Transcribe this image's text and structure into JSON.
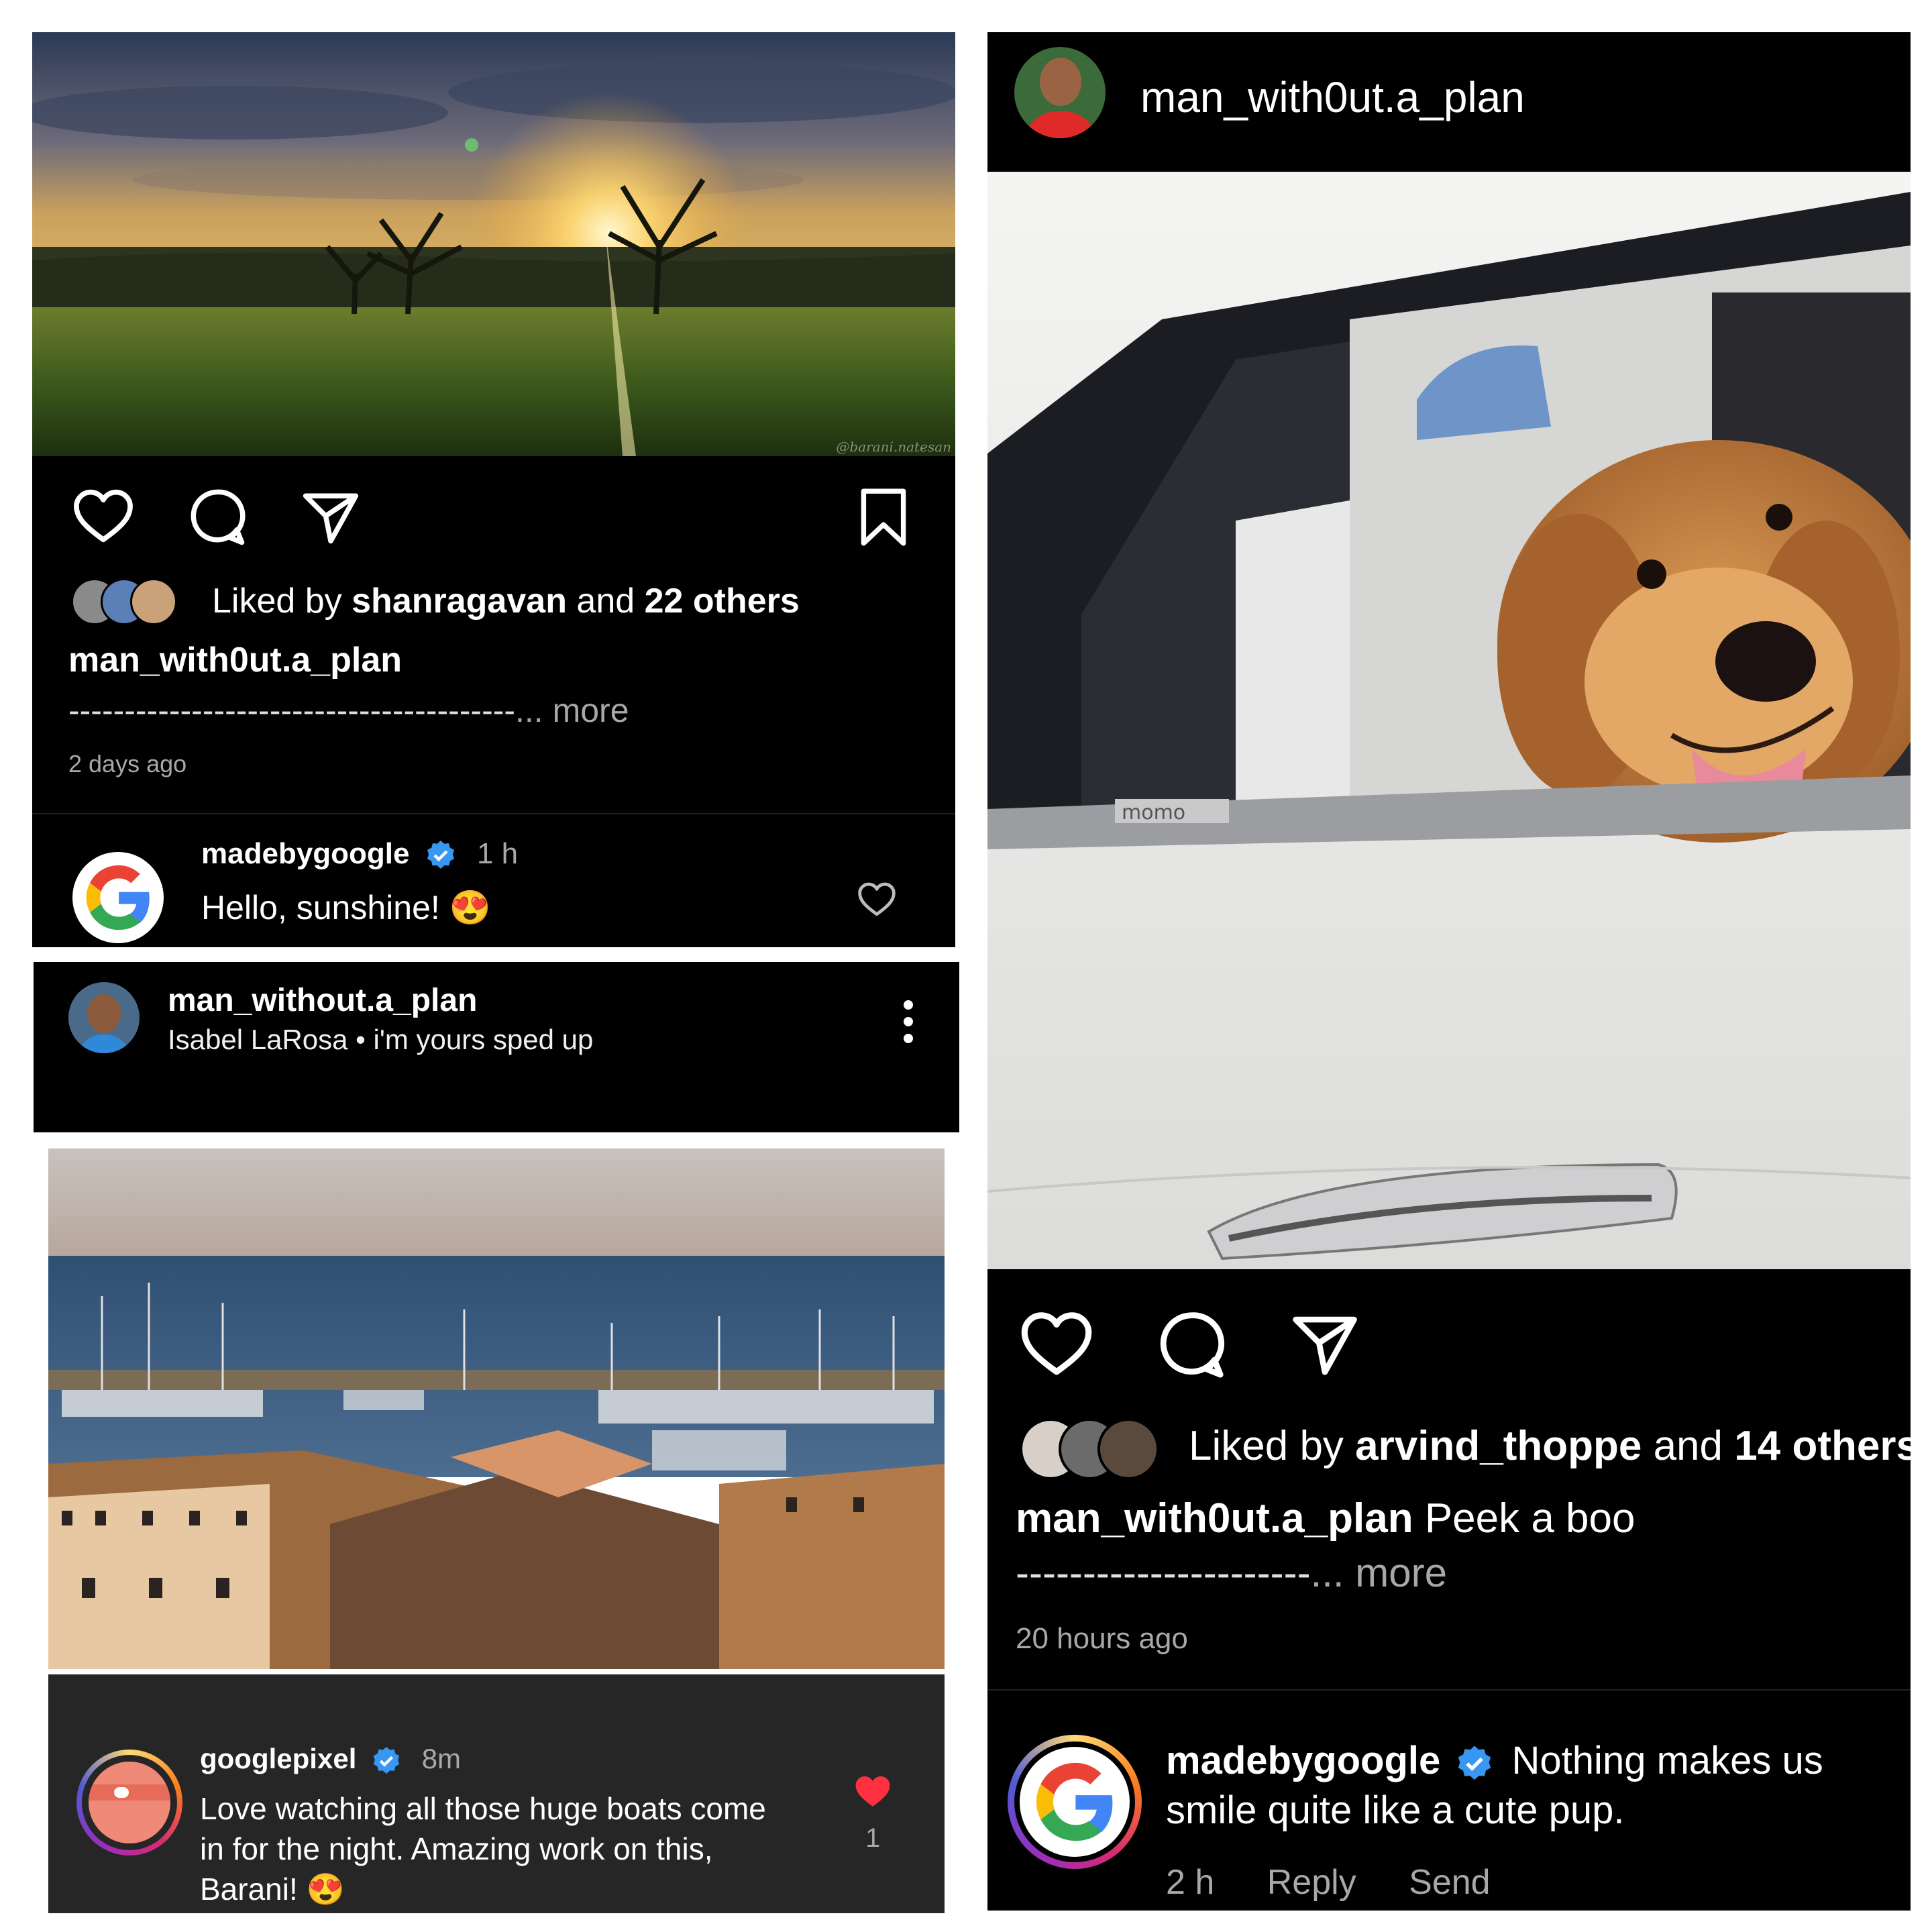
{
  "post1": {
    "photo_watermark": "@barani.natesan",
    "liked_prefix": "Liked by",
    "liked_user": "shanragavan",
    "liked_and": "and",
    "liked_others": "22 others",
    "author": "man_with0ut.a_plan",
    "caption_dashes": "----------------------------------------",
    "caption_more": "... more",
    "time": "2 days ago",
    "comment": {
      "user": "madebygoogle",
      "time": "1 h",
      "text": "Hello, sunshine! 😍"
    }
  },
  "music": {
    "user": "man_without.a_plan",
    "track": "Isabel LaRosa • i'm yours sped up"
  },
  "post2": {
    "comment": {
      "user": "googlepixel",
      "time": "8m",
      "text_line1": "Love watching all those huge boats come",
      "text_line2": "in for the night. Amazing work on this,",
      "text_line3": "Barani! 😍",
      "like_count": "1"
    }
  },
  "post3": {
    "header_user": "man_with0ut.a_plan",
    "car_badge": "momo",
    "liked_prefix": "Liked by",
    "liked_user": "arvind_thoppe",
    "liked_and": "and",
    "liked_others": "14 others",
    "author": "man_with0ut.a_plan",
    "caption": "Peek a boo",
    "caption_dashes": "----------------------",
    "caption_more": "... more",
    "time": "20 hours ago",
    "comment": {
      "user": "madebygoogle",
      "text_line1": "Nothing makes us",
      "text_line2": "smile quite like a cute pup.",
      "time": "2 h",
      "reply": "Reply",
      "send": "Send"
    }
  },
  "colors": {
    "background": "#000000",
    "verified": "#3897f0",
    "heart_red": "#ff3040",
    "gray_text": "#a8a8a8",
    "comment_panel": "#262626"
  }
}
